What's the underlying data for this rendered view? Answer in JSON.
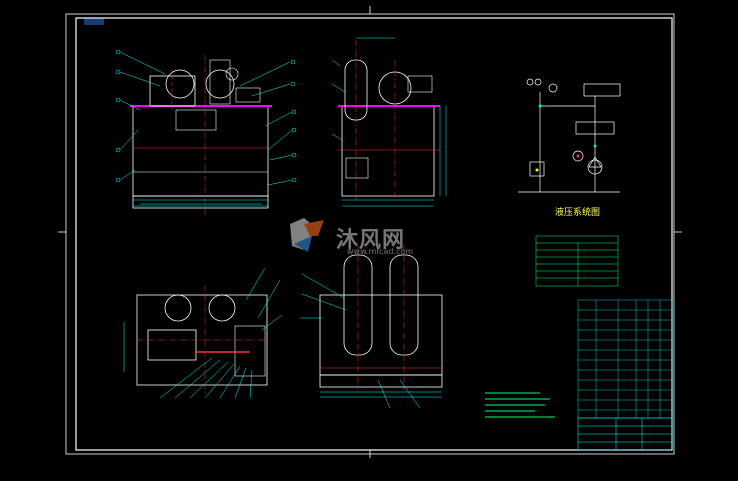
{
  "drawing": {
    "stamp_text": "",
    "system_diagram_title": "液压系统图",
    "parameter_table_title": "",
    "title_block_name": ""
  },
  "watermark": {
    "brand": "沐风网",
    "url": "www.mfcad.com"
  },
  "colors": {
    "background": "#000000",
    "frame": "#ffffff",
    "outline": "#ffffff",
    "centerline": "#ff3030",
    "leader": "#00ffff",
    "dimension": "#00ffff",
    "highlight": "#ff00ff",
    "table": "#00ff66",
    "title_block": "#00ffff",
    "system_title": "#ffff66"
  }
}
